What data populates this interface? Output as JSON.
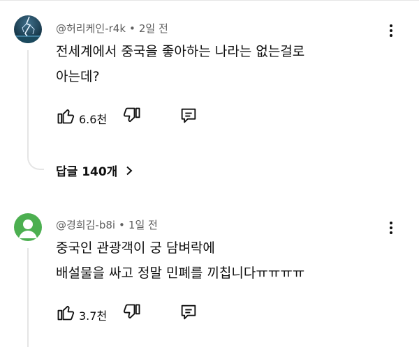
{
  "comments": [
    {
      "author": "@허리케인-r4k",
      "time": "2일 전",
      "text_lines": [
        "전세계에서 중국을 좋아하는 나라는 없는걸로",
        "아는데?"
      ],
      "like_count": "6.6천",
      "replies_label": "답글 140개",
      "avatar": "lightning-avatar"
    },
    {
      "author": "@경희김-b8i",
      "time": "1일 전",
      "text_lines": [
        "중국인 관광객이 궁 담벼락에",
        "배설물을 싸고 정말 민폐를 끼칩니다ㅠㅠㅠㅠ"
      ],
      "like_count": "3.7천",
      "avatar": "default-green-avatar"
    }
  ],
  "separator": "•",
  "colors": {
    "text_primary": "#0f0f0f",
    "text_secondary": "#606060",
    "avatar_green": "#4caf50",
    "avatar_dark": "#0d2a3a"
  },
  "icons": [
    "thumb-up-icon",
    "thumb-down-icon",
    "reply-icon",
    "more-vert-icon",
    "chevron-right-icon"
  ]
}
